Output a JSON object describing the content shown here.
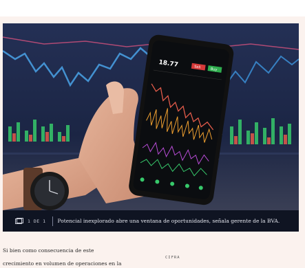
{
  "gallery": {
    "counter": "1 DE 1",
    "caption": "Potencial inexplorado abre una ventana de oportunidades, señala gerente de la BVA.",
    "photo_alt": "Mano sosteniendo un teléfono con gráficos de bolsa frente a pantallas con gráficas",
    "phone": {
      "price": "18.77",
      "sell_label": "Sell",
      "buy_label": "Buy"
    },
    "icon": "gallery-icon"
  },
  "article": {
    "lines": [
      "Si bien como consecuencia de este",
      "crecimiento en volumen de operaciones en la"
    ]
  },
  "sidebar": {
    "label": "CIFRA"
  },
  "colors": {
    "page_background": "#fbf2ee",
    "caption_bar": "#0f1422",
    "chart_blue": "#4aa3e8",
    "chart_green": "#37c96b",
    "chart_red": "#e25b4a"
  }
}
